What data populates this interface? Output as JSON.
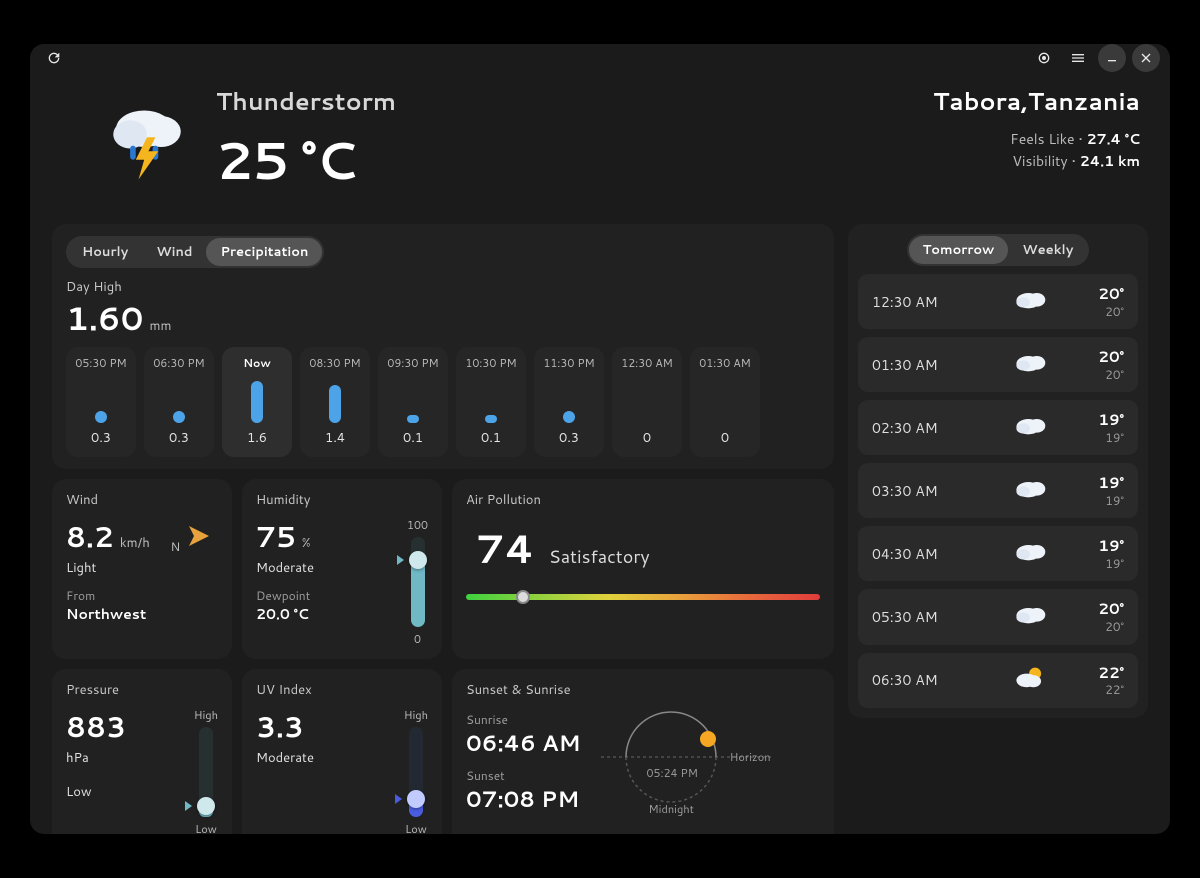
{
  "hdr": {
    "condition": "Thunderstorm",
    "temp": "25 °C",
    "city": "Tabora,Tanzania",
    "feels_lbl": "Feels Like",
    "feels_val": "27.4 °C",
    "vis_lbl": "Visibility",
    "vis_val": "24.1 km"
  },
  "hourly_tabs": {
    "a": "Hourly",
    "b": "Wind",
    "c": "Precipitation",
    "active": 2
  },
  "dayhigh": {
    "label": "Day High",
    "value": "1.60",
    "unit": "mm"
  },
  "hours": [
    {
      "time": "05:30 PM",
      "val": "0.3",
      "h": 12,
      "now": false
    },
    {
      "time": "06:30 PM",
      "val": "0.3",
      "h": 12,
      "now": false
    },
    {
      "time": "Now",
      "val": "1.6",
      "h": 42,
      "now": true
    },
    {
      "time": "08:30 PM",
      "val": "1.4",
      "h": 38,
      "now": false
    },
    {
      "time": "09:30 PM",
      "val": "0.1",
      "h": 8,
      "now": false
    },
    {
      "time": "10:30 PM",
      "val": "0.1",
      "h": 8,
      "now": false
    },
    {
      "time": "11:30 PM",
      "val": "0.3",
      "h": 12,
      "now": false
    },
    {
      "time": "12:30 AM",
      "val": "0",
      "h": 0,
      "now": false
    },
    {
      "time": "01:30 AM",
      "val": "0",
      "h": 0,
      "now": false
    }
  ],
  "wind": {
    "title": "Wind",
    "val": "8.2",
    "unit": "km/h",
    "desc": "Light",
    "from_lbl": "From",
    "from": "Northwest",
    "compass": "N"
  },
  "hum": {
    "title": "Humidity",
    "val": "75",
    "unit": "%",
    "desc": "Moderate",
    "dew_lbl": "Dewpoint",
    "dew": "20.0 °C",
    "top": "100",
    "bot": "0",
    "pct": 75
  },
  "air": {
    "title": "Air Pollution",
    "val": "74",
    "desc": "Satisfactory",
    "pct": 14
  },
  "press": {
    "title": "Pressure",
    "val": "883",
    "unit": "hPa",
    "desc": "Low",
    "top": "High",
    "bot": "Low",
    "pct": 12
  },
  "uv": {
    "title": "UV Index",
    "val": "3.3",
    "desc": "Moderate",
    "top": "High",
    "bot": "Low",
    "pct": 20
  },
  "sun": {
    "title": "Sunset & Sunrise",
    "rise_lbl": "Sunrise",
    "rise": "06:46 AM",
    "set_lbl": "Sunset",
    "set": "07:08 PM",
    "now": "05:24 PM",
    "horizon": "Horizon",
    "midnight": "Midnight"
  },
  "fc_tabs": {
    "a": "Tomorrow",
    "b": "Weekly",
    "active": 0
  },
  "forecast": [
    {
      "time": "12:30 AM",
      "hi": "20°",
      "lo": "20°",
      "icon": "cloud"
    },
    {
      "time": "01:30 AM",
      "hi": "20°",
      "lo": "20°",
      "icon": "cloud"
    },
    {
      "time": "02:30 AM",
      "hi": "19°",
      "lo": "19°",
      "icon": "cloud"
    },
    {
      "time": "03:30 AM",
      "hi": "19°",
      "lo": "19°",
      "icon": "cloud"
    },
    {
      "time": "04:30 AM",
      "hi": "19°",
      "lo": "19°",
      "icon": "cloud"
    },
    {
      "time": "05:30 AM",
      "hi": "20°",
      "lo": "20°",
      "icon": "cloud"
    },
    {
      "time": "06:30 AM",
      "hi": "22°",
      "lo": "22°",
      "icon": "partly"
    }
  ]
}
